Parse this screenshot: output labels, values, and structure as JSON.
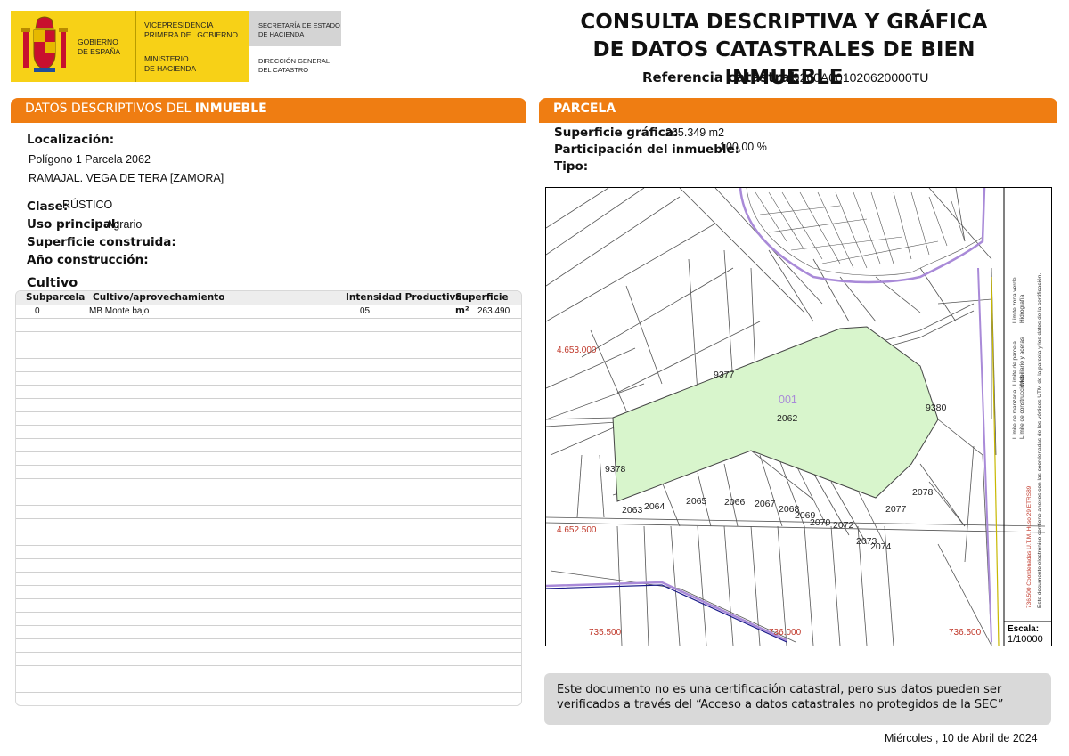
{
  "header": {
    "logo": {
      "gov_line1": "GOBIERNO",
      "gov_line2": "DE ESPAÑA",
      "vp_line1": "VICEPRESIDENCIA",
      "vp_line2": "PRIMERA DEL GOBIERNO",
      "min_line1": "MINISTERIO",
      "min_line2": "DE HACIENDA",
      "sec_line1": "SECRETARÍA DE ESTADO",
      "sec_line2": "DE HACIENDA",
      "dg_line1": "DIRECCIÓN GENERAL",
      "dg_line2": "DEL CATASTRO"
    },
    "title_line1": "CONSULTA DESCRIPTIVA Y GRÁFICA",
    "title_line2": "DE DATOS CATASTRALES DE BIEN INMUEBLE",
    "ref_label": "Referencia catastral:",
    "ref_value": "49260A001020620000TU"
  },
  "left": {
    "bar_prefix": "DATOS DESCRIPTIVOS DEL ",
    "bar_bold": "INMUEBLE",
    "localizacion_label": "Localización:",
    "localizacion_line1": "Polígono 1 Parcela 2062",
    "localizacion_line2": "RAMAJAL. VEGA DE TERA [ZAMORA]",
    "clase_label": "Clase:",
    "clase_value": "RÚSTICO",
    "uso_label": "Uso principal:",
    "uso_value": "Agrario",
    "superficie_label": "Superficie construida:",
    "anio_label": "Año construcción:",
    "cultivo_label": "Cultivo",
    "table": {
      "headers": [
        "Subparcela",
        "Cultivo/aprovechamiento",
        "Intensidad Productiva",
        "Superficie m²"
      ],
      "rows": [
        {
          "subparcela": "0",
          "cultivo": "MB Monte bajo",
          "intensidad": "05",
          "superficie": "263.490"
        }
      ]
    }
  },
  "right": {
    "bar_title": "PARCELA",
    "sup_label": "Superficie gráfica:",
    "sup_value": "265.349 m2",
    "part_label": "Participación del inmueble:",
    "part_value": "100,00 %",
    "tipo_label": "Tipo:",
    "map": {
      "parcel_number": "2062",
      "parcel_code": "001",
      "labels": [
        "9377",
        "9380",
        "9378",
        "2063",
        "2064",
        "2065",
        "2066",
        "2067",
        "2068",
        "2069",
        "2070",
        "2072",
        "2073",
        "2074",
        "2077",
        "2078"
      ],
      "coord_y1": "4.653.000",
      "coord_y2": "4.652.500",
      "coord_x1": "735.500",
      "coord_x2": "736.000",
      "coord_x3": "736.500",
      "side_legend": "Este documento electrónico contiene anexos con las coordenadas de los vértices UTM de la parcela y los datos de la certificación.",
      "legend_items": [
        "Límite de manzana",
        "Límite de parcela",
        "Límite de construcciones",
        "Mobiliario y aceras",
        "Límite zona verde",
        "Hidrografía"
      ],
      "utm_note": "736.500 Coordenadas U.T.M. Huso 29 ETRS89",
      "scale_label": "Escala:",
      "scale_value": "1/10000",
      "colors": {
        "parcel_fill": "#d8f5cc",
        "parcel_line": "#a98ad8",
        "coords": "#c0392b"
      }
    },
    "note": "Este documento no es una certificación catastral, pero sus datos pueden ser verificados a través del “Acceso a datos catastrales no protegidos de la SEC”"
  },
  "footer": {
    "date": "Miércoles , 10 de Abril de 2024"
  }
}
